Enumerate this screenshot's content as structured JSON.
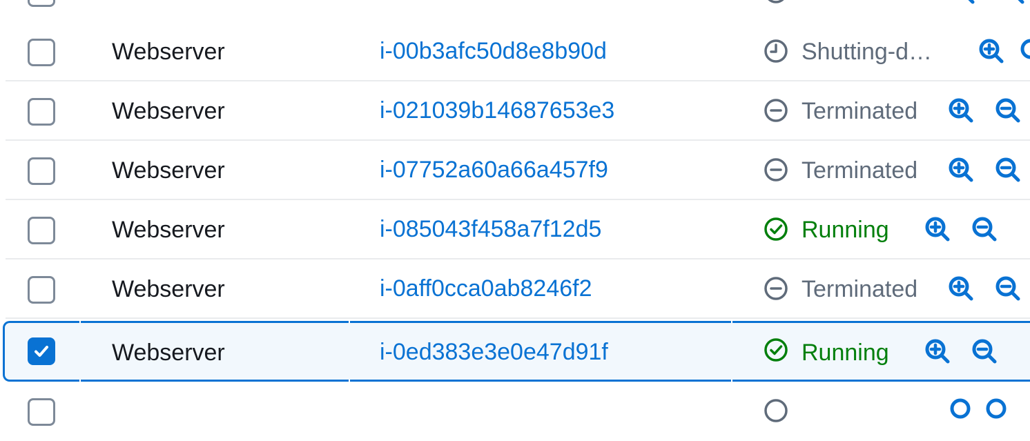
{
  "colors": {
    "link": "#0972d3",
    "running": "#037f0c",
    "muted": "#5f6b7a",
    "text": "#16191f",
    "selected_border": "#0972d3",
    "selected_bg": "#f2f8fd"
  },
  "rows": [
    {
      "name": "Webserver",
      "instance_id": "i-00b3afc50d8e8b90d",
      "state": "Shutting-d…",
      "state_icon": "clock-icon",
      "selected": false
    },
    {
      "name": "Webserver",
      "instance_id": "i-021039b14687653e3",
      "state": "Terminated",
      "state_icon": "minus-circle-icon",
      "selected": false
    },
    {
      "name": "Webserver",
      "instance_id": "i-07752a60a66a457f9",
      "state": "Terminated",
      "state_icon": "minus-circle-icon",
      "selected": false
    },
    {
      "name": "Webserver",
      "instance_id": "i-085043f458a7f12d5",
      "state": "Running",
      "state_icon": "check-circle-icon",
      "selected": false
    },
    {
      "name": "Webserver",
      "instance_id": "i-0aff0cca0ab8246f2",
      "state": "Terminated",
      "state_icon": "minus-circle-icon",
      "selected": false
    },
    {
      "name": "Webserver",
      "instance_id": "i-0ed383e3e0e47d91f",
      "state": "Running",
      "state_icon": "check-circle-icon",
      "selected": true
    }
  ]
}
